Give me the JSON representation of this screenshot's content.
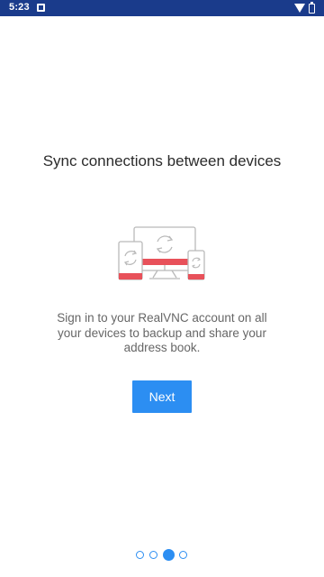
{
  "status_bar": {
    "time": "5:23",
    "icons": [
      "app-notification-icon",
      "wifi-icon",
      "battery-icon"
    ]
  },
  "onboarding": {
    "title": "Sync connections between devices",
    "illustration": "sync-devices-illustration",
    "description": "Sign in to your RealVNC account on all your devices to backup and share your address book.",
    "next_label": "Next"
  },
  "pagination": {
    "total": 4,
    "active_index": 2
  },
  "colors": {
    "status_bar": "#1a3b8b",
    "accent": "#2c8ef2",
    "illustration_red": "#e8515a",
    "title_text": "#2b2b2b",
    "body_text": "#666666"
  }
}
